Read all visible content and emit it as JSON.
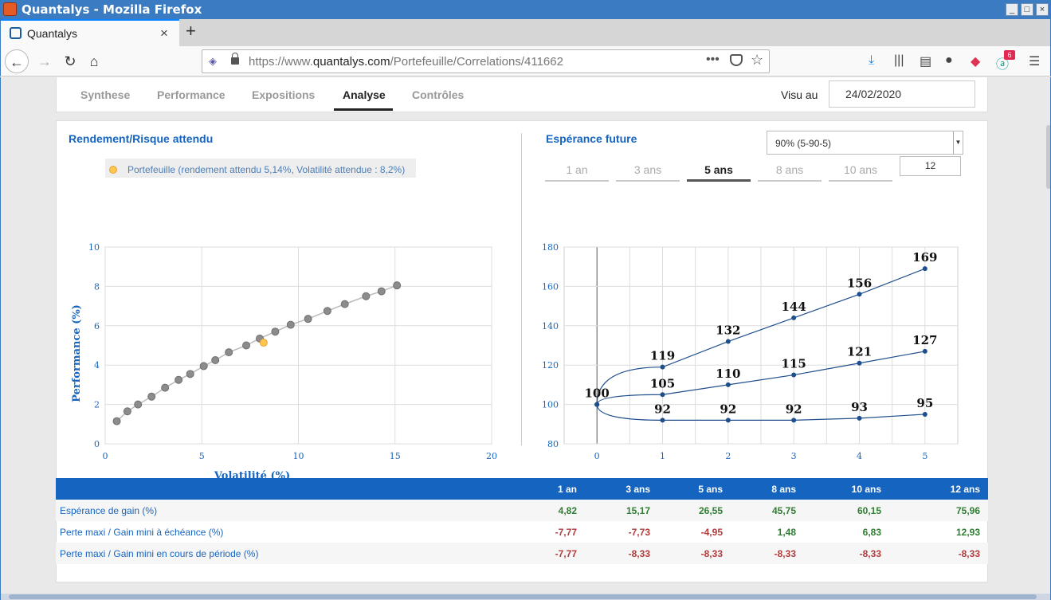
{
  "window": {
    "title": "Quantalys - Mozilla Firefox"
  },
  "browser": {
    "tab_label": "Quantalys",
    "url_prefix": "https://www.",
    "url_domain": "quantalys.com",
    "url_path": "/Portefeuille/Correlations/411662",
    "notification_count": "6"
  },
  "nav": {
    "tabs": [
      "Synthese",
      "Performance",
      "Expositions",
      "Analyse",
      "Contrôles"
    ],
    "visu_label": "Visu au",
    "visu_date": "24/02/2020"
  },
  "left_panel": {
    "title": "Rendement/Risque attendu",
    "legend": "Portefeuille (rendement attendu 5,14%, Volatilité attendue : 8,2%)"
  },
  "right_panel": {
    "title": "Espérance future",
    "select_value": "90% (5-90-5)",
    "horizon_tabs": [
      "1 an",
      "3 ans",
      "5 ans",
      "8 ans",
      "10 ans"
    ],
    "horizon_input": "12"
  },
  "chart_data": [
    {
      "type": "scatter",
      "title": "",
      "xlabel": "Volatilité (%)",
      "ylabel": "Performance (%)",
      "xlim": [
        0,
        20
      ],
      "ylim": [
        0,
        10
      ],
      "xticks": [
        0,
        5,
        10,
        15,
        20
      ],
      "yticks": [
        0,
        2,
        4,
        6,
        8,
        10
      ],
      "grid": true,
      "series": [
        {
          "name": "",
          "color": "#888888",
          "x": [
            0.6,
            1.15,
            1.7,
            2.4,
            3.1,
            3.8,
            4.4,
            5.1,
            5.7,
            6.4,
            7.3,
            8.0,
            8.8,
            9.6,
            10.5,
            11.5,
            12.4,
            13.5,
            14.3,
            15.1
          ],
          "y": [
            1.15,
            1.65,
            2.0,
            2.4,
            2.85,
            3.25,
            3.55,
            3.95,
            4.25,
            4.65,
            5.0,
            5.35,
            5.7,
            6.05,
            6.35,
            6.75,
            7.1,
            7.5,
            7.75,
            8.05
          ]
        },
        {
          "name": "Portefeuille (rendement attendu 5,14%, Volatilité attendue : 8,2%)",
          "color": "#ffc74f",
          "x": [
            8.2
          ],
          "y": [
            5.14
          ]
        }
      ]
    },
    {
      "type": "line",
      "title": "",
      "xlabel": "",
      "ylabel": "",
      "xlim": [
        -0.5,
        5.5
      ],
      "ylim": [
        80,
        180
      ],
      "xticks": [
        0,
        1,
        2,
        3,
        4,
        5
      ],
      "yticks": [
        80,
        100,
        120,
        140,
        160,
        180
      ],
      "grid": true,
      "line_color": "#1f4e8c",
      "series": [
        {
          "name": "",
          "x": [
            0,
            1,
            2,
            3,
            4,
            5
          ],
          "values": [
            100,
            119,
            132,
            144,
            156,
            169
          ]
        },
        {
          "name": "",
          "x": [
            0,
            1,
            2,
            3,
            4,
            5
          ],
          "values": [
            100,
            105,
            110,
            115,
            121,
            127
          ]
        },
        {
          "name": "",
          "x": [
            0,
            1,
            2,
            3,
            4,
            5
          ],
          "values": [
            100,
            92,
            92,
            92,
            93,
            95
          ]
        }
      ]
    }
  ],
  "table": {
    "headers": [
      "",
      "1 an",
      "3 ans",
      "5 ans",
      "8 ans",
      "10 ans",
      "12 ans"
    ],
    "rows": [
      {
        "label": "Espérance de gain (%)",
        "values": [
          "4,82",
          "15,17",
          "26,55",
          "45,75",
          "60,15",
          "75,96"
        ]
      },
      {
        "label": "Perte maxi / Gain mini à échéance (%)",
        "values": [
          "-7,77",
          "-7,73",
          "-4,95",
          "1,48",
          "6,83",
          "12,93"
        ]
      },
      {
        "label": "Perte maxi / Gain mini en cours de période (%)",
        "values": [
          "-7,77",
          "-8,33",
          "-8,33",
          "-8,33",
          "-8,33",
          "-8,33"
        ]
      }
    ]
  }
}
